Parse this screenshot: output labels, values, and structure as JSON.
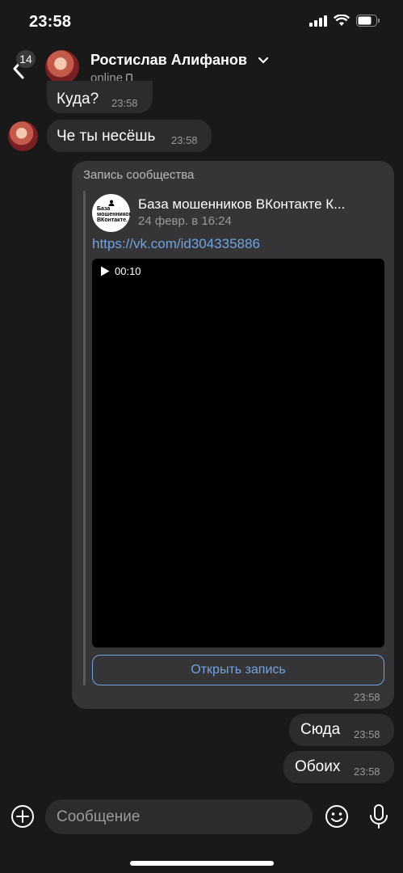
{
  "status_bar": {
    "time": "23:58"
  },
  "header": {
    "unread_badge": "14",
    "contact_name": "Ростислав Алифанов",
    "contact_status": "online"
  },
  "messages": [
    {
      "text": "Куда?",
      "time": "23:58",
      "direction": "incoming"
    },
    {
      "text": "Че ты несёшь",
      "time": "23:58",
      "direction": "incoming"
    },
    {
      "text": "Сюда",
      "time": "23:58",
      "direction": "outgoing"
    },
    {
      "text": "Обоих",
      "time": "23:58",
      "direction": "outgoing"
    }
  ],
  "post": {
    "header": "Запись сообщества",
    "group_name": "База мошенников ВКонтакте  К...",
    "group_logo_text": "База мошенников ВКонтакте.",
    "date": "24 февр. в 16:24",
    "link": "https://vk.com/id304335886",
    "video_duration": "00:10",
    "open_button": "Открыть запись",
    "time": "23:58"
  },
  "composer": {
    "placeholder": "Сообщение"
  },
  "colors": {
    "background": "#191919",
    "bubble": "#2c2c2e",
    "link": "#71a3e0"
  }
}
